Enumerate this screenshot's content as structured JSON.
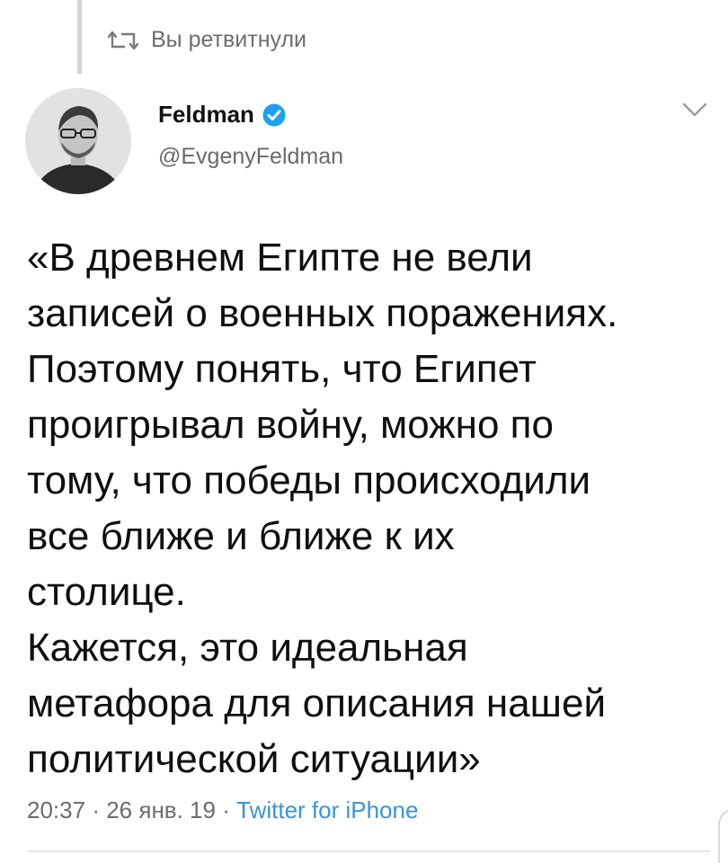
{
  "retweet": {
    "label": "Вы ретвитнули",
    "icon": "retweet-icon"
  },
  "author": {
    "display_name": "Feldman",
    "handle": "@EvgenyFeldman",
    "verified": true,
    "verified_color": "#1da1f2"
  },
  "tweet": {
    "lines": [
      "«В древнем Египте не вели",
      "записей о военных поражениях.",
      "Поэтому понять, что Египет",
      "проигрывал войну, можно по",
      "тому, что победы происходили",
      "все ближе и ближе к их",
      "столице.",
      "Кажется, это идеальная",
      "метафора для описания нашей",
      "политической ситуации»"
    ]
  },
  "meta": {
    "time": "20:37",
    "separator": "·",
    "date": "26 янв. 19",
    "source": "Twitter for iPhone",
    "source_color": "#3a93d9"
  }
}
